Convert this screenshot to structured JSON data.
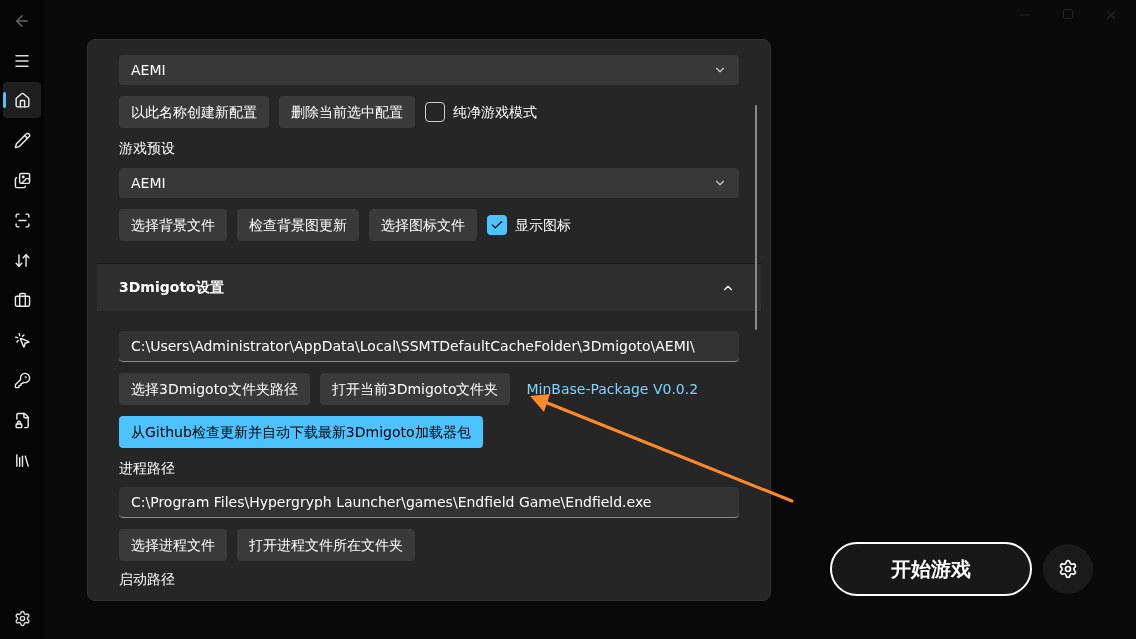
{
  "sidebar": {
    "items": [
      {
        "selected": true
      },
      {
        "selected": false
      },
      {
        "selected": false
      },
      {
        "selected": false
      },
      {
        "selected": false
      },
      {
        "selected": false
      },
      {
        "selected": false
      },
      {
        "selected": false
      },
      {
        "selected": false
      },
      {
        "selected": false
      }
    ]
  },
  "config": {
    "name_dropdown": {
      "value": "AEMI"
    },
    "buttons": [
      "以此名称创建新配置",
      "删除当前选中配置"
    ],
    "clean_mode": {
      "label": "纯净游戏模式",
      "checked": false
    },
    "preset_label": "游戏预设",
    "preset_dropdown": {
      "value": "AEMI"
    },
    "background_buttons": [
      "选择背景文件",
      "检查背景图更新",
      "选择图标文件"
    ],
    "show_icon": {
      "label": "显示图标",
      "checked": true
    }
  },
  "migoto": {
    "title": "3Dmigoto设置",
    "expanded": true,
    "folder_path": {
      "value": "C:\\Users\\Administrator\\AppData\\Local\\SSMTDefaultCacheFolder\\3Dmigoto\\AEMI\\"
    },
    "folder_buttons": [
      "选择3Dmigoto文件夹路径",
      "打开当前3Dmigoto文件夹"
    ],
    "package_link": "MinBase-Package V0.0.2",
    "update_button": "从Github检查更新并自动下载最新3Dmigoto加载器包",
    "process_label": "进程路径",
    "process_path": {
      "value": "C:\\Program Files\\Hypergryph Launcher\\games\\Endfield Game\\Endfield.exe"
    },
    "process_buttons": [
      "选择进程文件",
      "打开进程文件所在文件夹"
    ],
    "launch_label": "启动路径"
  },
  "start_button": "开始游戏"
}
